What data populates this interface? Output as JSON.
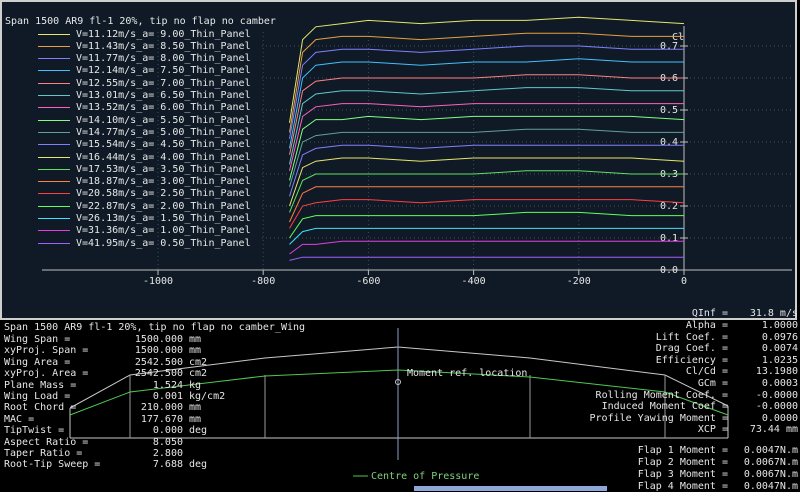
{
  "graph": {
    "title": "Span 1500 AR9 fl-1 20%, tip no flap no camber",
    "legend": [
      {
        "label": "V=11.12m/s_a= 9.00_Thin_Panel",
        "color": "#e8e66b"
      },
      {
        "label": "V=11.43m/s_a= 8.50_Thin_Panel",
        "color": "#e8a040"
      },
      {
        "label": "V=11.77m/s_a= 8.00_Thin_Panel",
        "color": "#8080ff"
      },
      {
        "label": "V=12.14m/s_a= 7.50_Thin_Panel",
        "color": "#40c0ff"
      },
      {
        "label": "V=12.55m/s_a= 7.00_Thin_Panel",
        "color": "#ff8080"
      },
      {
        "label": "V=13.01m/s_a= 6.50_Thin_Panel",
        "color": "#60c8c8"
      },
      {
        "label": "V=13.52m/s_a= 6.00_Thin_Panel",
        "color": "#ff60c0"
      },
      {
        "label": "V=14.10m/s_a= 5.50_Thin_Panel",
        "color": "#80ff80"
      },
      {
        "label": "V=14.77m/s_a= 5.00_Thin_Panel",
        "color": "#60a0a0"
      },
      {
        "label": "V=15.54m/s_a= 4.50_Thin_Panel",
        "color": "#8080ff"
      },
      {
        "label": "V=16.44m/s_a= 4.00_Thin_Panel",
        "color": "#e8e66b"
      },
      {
        "label": "V=17.53m/s_a= 3.50_Thin_Panel",
        "color": "#60e060"
      },
      {
        "label": "V=18.87m/s_a= 3.00_Thin_Panel",
        "color": "#ff8040"
      },
      {
        "label": "V=20.58m/s_a= 2.50_Thin_Panel",
        "color": "#ff4040"
      },
      {
        "label": "V=22.87m/s_a= 2.00_Thin_Panel",
        "color": "#60ff60"
      },
      {
        "label": "V=26.13m/s_a= 1.50_Thin_Panel",
        "color": "#40e0ff"
      },
      {
        "label": "V=31.36m/s_a= 1.00_Thin_Panel",
        "color": "#e040e0"
      },
      {
        "label": "V=41.95m/s_a= 0.50_Thin_Panel",
        "color": "#a060ff"
      }
    ],
    "x_ticks": [
      "-1000",
      "-800",
      "-600",
      "-400",
      "-200",
      "0"
    ],
    "y_ticks": [
      "0.0",
      "0.1",
      "0.2",
      "0.3",
      "0.4",
      "0.5",
      "0.6",
      "0.7"
    ],
    "y_axis_name": "Cl"
  },
  "chart_data": {
    "type": "line",
    "title": "Span 1500 AR9 fl-1 20%, tip no flap no camber",
    "xlim": [
      -1000,
      0
    ],
    "ylim": [
      0,
      0.75
    ],
    "ylabel": "Cl",
    "x": [
      -750,
      -725,
      -700,
      -650,
      -600,
      -500,
      -400,
      -300,
      -200,
      -100,
      0
    ],
    "series": [
      {
        "name": "V=11.12m/s_a= 9.00_Thin_Panel",
        "values": [
          0.46,
          0.72,
          0.76,
          0.77,
          0.78,
          0.77,
          0.78,
          0.78,
          0.79,
          0.78,
          0.77
        ]
      },
      {
        "name": "V=11.43m/s_a= 8.50_Thin_Panel",
        "values": [
          0.43,
          0.68,
          0.72,
          0.73,
          0.73,
          0.72,
          0.73,
          0.74,
          0.74,
          0.73,
          0.73
        ]
      },
      {
        "name": "V=11.77m/s_a= 8.00_Thin_Panel",
        "values": [
          0.41,
          0.64,
          0.68,
          0.69,
          0.69,
          0.68,
          0.69,
          0.7,
          0.7,
          0.69,
          0.69
        ]
      },
      {
        "name": "V=12.14m/s_a= 7.50_Thin_Panel",
        "values": [
          0.38,
          0.6,
          0.64,
          0.65,
          0.65,
          0.64,
          0.65,
          0.65,
          0.66,
          0.65,
          0.65
        ]
      },
      {
        "name": "V=12.55m/s_a= 7.00_Thin_Panel",
        "values": [
          0.36,
          0.56,
          0.59,
          0.6,
          0.6,
          0.6,
          0.6,
          0.61,
          0.61,
          0.6,
          0.6
        ]
      },
      {
        "name": "V=13.01m/s_a= 6.50_Thin_Panel",
        "values": [
          0.33,
          0.52,
          0.55,
          0.56,
          0.56,
          0.55,
          0.56,
          0.57,
          0.57,
          0.56,
          0.56
        ]
      },
      {
        "name": "V=13.52m/s_a= 6.00_Thin_Panel",
        "values": [
          0.31,
          0.48,
          0.51,
          0.52,
          0.52,
          0.51,
          0.52,
          0.52,
          0.52,
          0.52,
          0.52
        ]
      },
      {
        "name": "V=14.10m/s_a= 5.50_Thin_Panel",
        "values": [
          0.28,
          0.44,
          0.47,
          0.47,
          0.48,
          0.47,
          0.48,
          0.48,
          0.48,
          0.48,
          0.47
        ]
      },
      {
        "name": "V=14.77m/s_a= 5.00_Thin_Panel",
        "values": [
          0.26,
          0.4,
          0.42,
          0.43,
          0.43,
          0.43,
          0.43,
          0.44,
          0.44,
          0.43,
          0.43
        ]
      },
      {
        "name": "V=15.54m/s_a= 4.50_Thin_Panel",
        "values": [
          0.23,
          0.36,
          0.38,
          0.39,
          0.39,
          0.38,
          0.39,
          0.39,
          0.39,
          0.39,
          0.39
        ]
      },
      {
        "name": "V=16.44m/s_a= 4.00_Thin_Panel",
        "values": [
          0.2,
          0.32,
          0.34,
          0.35,
          0.35,
          0.34,
          0.35,
          0.35,
          0.35,
          0.35,
          0.34
        ]
      },
      {
        "name": "V=17.53m/s_a= 3.50_Thin_Panel",
        "values": [
          0.18,
          0.28,
          0.3,
          0.3,
          0.3,
          0.3,
          0.3,
          0.31,
          0.31,
          0.3,
          0.3
        ]
      },
      {
        "name": "V=18.87m/s_a= 3.00_Thin_Panel",
        "values": [
          0.15,
          0.24,
          0.26,
          0.26,
          0.26,
          0.26,
          0.26,
          0.26,
          0.26,
          0.26,
          0.26
        ]
      },
      {
        "name": "V=20.58m/s_a= 2.50_Thin_Panel",
        "values": [
          0.13,
          0.2,
          0.21,
          0.22,
          0.22,
          0.21,
          0.22,
          0.22,
          0.22,
          0.22,
          0.21
        ]
      },
      {
        "name": "V=22.87m/s_a= 2.00_Thin_Panel",
        "values": [
          0.1,
          0.16,
          0.17,
          0.17,
          0.17,
          0.17,
          0.17,
          0.18,
          0.18,
          0.17,
          0.17
        ]
      },
      {
        "name": "V=26.13m/s_a= 1.50_Thin_Panel",
        "values": [
          0.08,
          0.12,
          0.13,
          0.13,
          0.13,
          0.13,
          0.13,
          0.13,
          0.13,
          0.13,
          0.13
        ]
      },
      {
        "name": "V=31.36m/s_a= 1.00_Thin_Panel",
        "values": [
          0.05,
          0.08,
          0.08,
          0.09,
          0.09,
          0.09,
          0.09,
          0.09,
          0.09,
          0.09,
          0.09
        ]
      },
      {
        "name": "V=41.95m/s_a= 0.50_Thin_Panel",
        "values": [
          0.03,
          0.04,
          0.04,
          0.04,
          0.04,
          0.04,
          0.04,
          0.04,
          0.04,
          0.04,
          0.04
        ]
      }
    ]
  },
  "wing": {
    "title": "Span 1500 AR9 fl-1 20%, tip no flap no camber_Wing",
    "properties": [
      {
        "label": "Wing Span =",
        "value": "1500.000",
        "unit": "mm"
      },
      {
        "label": "xyProj. Span =",
        "value": "1500.000",
        "unit": "mm"
      },
      {
        "label": "Wing Area =",
        "value": "2542.500",
        "unit": "cm2"
      },
      {
        "label": "xyProj. Area =",
        "value": "2542.500",
        "unit": "cm2"
      },
      {
        "label": "Plane Mass =",
        "value": "1.524",
        "unit": "kg"
      },
      {
        "label": "Wing Load =",
        "value": "0.001",
        "unit": "kg/cm2"
      },
      {
        "label": "Root Chord =",
        "value": "210.000",
        "unit": "mm"
      },
      {
        "label": "MAC =",
        "value": "177.670",
        "unit": "mm"
      },
      {
        "label": "TipTwist =",
        "value": "0.000",
        "unit": "deg"
      },
      {
        "label": "Aspect Ratio =",
        "value": "8.050",
        "unit": ""
      },
      {
        "label": "Taper Ratio =",
        "value": "2.800",
        "unit": ""
      },
      {
        "label": "Root-Tip Sweep =",
        "value": "7.688",
        "unit": "deg"
      }
    ],
    "moment_ref_label": "Moment ref. location",
    "cp_legend_label": "Centre of Pressure"
  },
  "results": {
    "qinf": {
      "label": "QInf =",
      "value": "31.8 m/s"
    },
    "rows": [
      {
        "label": "Alpha =",
        "value": "1.0000"
      },
      {
        "label": "Lift Coef. =",
        "value": "0.0976"
      },
      {
        "label": "Drag Coef. =",
        "value": "0.0074"
      },
      {
        "label": "Efficiency =",
        "value": "1.0235"
      },
      {
        "label": "Cl/Cd =",
        "value": "13.1980"
      },
      {
        "label": "GCm =",
        "value": "0.0003"
      },
      {
        "label": "Rolling Moment Coef. =",
        "value": "-0.0000"
      },
      {
        "label": "Induced Moment Coef =",
        "value": "-0.0000"
      },
      {
        "label": "Profile Yawing Moment =",
        "value": "0.0000"
      },
      {
        "label": "XCP =",
        "value": "73.44 mm"
      }
    ],
    "flaps": [
      {
        "label": "Flap 1 Moment =",
        "value": "0.0047N.m"
      },
      {
        "label": "Flap 2 Moment =",
        "value": "0.0067N.m"
      },
      {
        "label": "Flap 3 Moment =",
        "value": "0.0067N.m"
      },
      {
        "label": "Flap 4 Moment =",
        "value": "0.0047N.m"
      }
    ]
  }
}
